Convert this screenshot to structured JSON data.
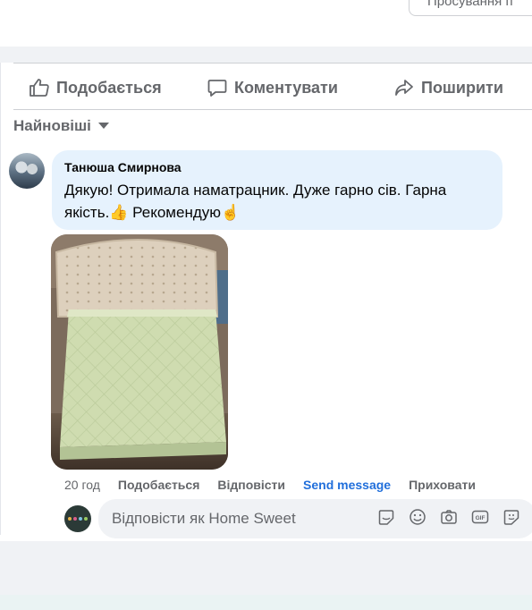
{
  "top": {
    "promote_label": "Просування п"
  },
  "actions": {
    "like_label": "Подобається",
    "comment_label": "Коментувати",
    "share_label": "Поширити"
  },
  "sort": {
    "label": "Найновіші"
  },
  "comment": {
    "author": "Танюша Смирнова",
    "text": "Дякую! Отримала наматрацник. Дуже гарно сів. Гарна якість.👍 Рекомендую☝️",
    "time": "20 год",
    "like_label": "Подобається",
    "reply_label": "Відповісти",
    "send_message_label": "Send message",
    "hide_label": "Приховати"
  },
  "reply": {
    "placeholder": "Відповісти як Home Sweet"
  },
  "icons": {
    "like": "thumbs-up-icon",
    "comment": "speech-bubble-icon",
    "share": "share-arrow-icon",
    "sort": "caret-down-icon",
    "reply_tools": [
      "sticker-icon",
      "emoji-icon",
      "camera-icon",
      "gif-icon",
      "avatar-sticker-icon"
    ]
  },
  "colors": {
    "bubble": "#e6f2fd",
    "link_blue": "#216fdb",
    "secondary_text": "#65676b",
    "page_gray": "#f0f2f5"
  }
}
